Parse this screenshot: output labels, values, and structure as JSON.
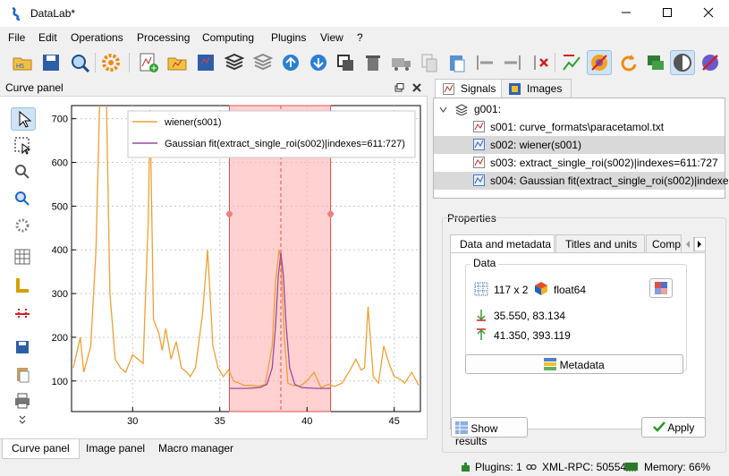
{
  "window": {
    "title": "DataLab*",
    "min_icon": "minimize-icon",
    "max_icon": "maximize-icon",
    "close_icon": "close-icon"
  },
  "menu": [
    "File",
    "Edit",
    "Operations",
    "Processing",
    "Computing",
    "Plugins",
    "View",
    "?"
  ],
  "curve_panel": {
    "title": "Curve panel",
    "legend": [
      "wiener(s001)",
      "Gaussian fit(extract_single_roi(s002)|indexes=611:727)"
    ],
    "bottom_tabs": [
      "Curve panel",
      "Image panel",
      "Macro manager"
    ]
  },
  "right_tabs": [
    "Signals",
    "Images"
  ],
  "tree": {
    "group": "g001:",
    "items": [
      "s001: curve_formats\\paracetamol.txt",
      "s002: wiener(s001)",
      "s003: extract_single_roi(s002)|indexes=611:727",
      "s004: Gaussian fit(extract_single_roi(s002)|indexe..."
    ]
  },
  "properties": {
    "title": "Properties",
    "tabs": [
      "Data and metadata",
      "Titles and units",
      "Compu"
    ],
    "data_group": "Data",
    "shape": "117 x 2",
    "dtype": "float64",
    "min": "35.550, 83.134",
    "max": "41.350, 393.119",
    "metadata_button": "Metadata",
    "show_results_button": "Show results",
    "apply_button": "Apply"
  },
  "status": {
    "plugins": "Plugins: 1",
    "xmlrpc": "XML-RPC: 50554",
    "memory": "Memory: 66%"
  },
  "colors": {
    "curve1": "#f0a030",
    "curve2": "#9c4aa0",
    "roi": "#ffb3b3",
    "accent": "#1a66c8"
  },
  "chart_data": {
    "type": "line",
    "xlim": [
      26.5,
      46.5
    ],
    "ylim": [
      30,
      730
    ],
    "xticks": [
      30,
      35,
      40,
      45
    ],
    "yticks": [
      100,
      200,
      300,
      400,
      500,
      600,
      700
    ],
    "roi": [
      35.55,
      41.35
    ],
    "cursor_x": 38.5,
    "series": [
      {
        "name": "wiener(s001)",
        "x": [
          26.6,
          27.0,
          27.2,
          27.6,
          27.9,
          28.1,
          28.3,
          28.5,
          28.7,
          29.0,
          29.3,
          29.6,
          30.0,
          30.3,
          30.6,
          30.9,
          31.0,
          31.2,
          31.5,
          31.7,
          31.9,
          32.2,
          32.5,
          32.8,
          33.1,
          33.3,
          33.6,
          34.0,
          34.3,
          34.6,
          34.9,
          35.2,
          35.5,
          35.8,
          36.1,
          36.4,
          36.8,
          37.2,
          37.6,
          38.0,
          38.2,
          38.4,
          38.5,
          38.7,
          38.9,
          39.2,
          39.6,
          40.0,
          40.4,
          40.8,
          41.2,
          41.6,
          42.0,
          42.4,
          42.8,
          43.1,
          43.3,
          43.5,
          43.8,
          44.1,
          44.4,
          44.7,
          45.0,
          45.3,
          45.6,
          46.0,
          46.4
        ],
        "y": [
          130,
          200,
          120,
          180,
          400,
          720,
          820,
          740,
          300,
          150,
          130,
          120,
          160,
          150,
          140,
          470,
          720,
          240,
          210,
          170,
          220,
          150,
          190,
          130,
          120,
          110,
          130,
          250,
          400,
          180,
          130,
          110,
          125,
          100,
          95,
          90,
          90,
          88,
          92,
          180,
          330,
          400,
          380,
          200,
          95,
          90,
          88,
          100,
          120,
          85,
          92,
          88,
          95,
          120,
          150,
          125,
          130,
          270,
          110,
          95,
          180,
          140,
          110,
          105,
          95,
          120,
          90
        ]
      },
      {
        "name": "Gaussian fit(extract_single_roi(s002)|indexes=611:727)",
        "x": [
          35.55,
          36.5,
          37.3,
          37.7,
          38.0,
          38.2,
          38.35,
          38.5,
          38.65,
          38.8,
          39.0,
          39.3,
          39.7,
          40.5,
          41.35
        ],
        "y": [
          83,
          83,
          85,
          92,
          130,
          230,
          340,
          393,
          340,
          230,
          130,
          92,
          85,
          83,
          83
        ]
      }
    ]
  }
}
